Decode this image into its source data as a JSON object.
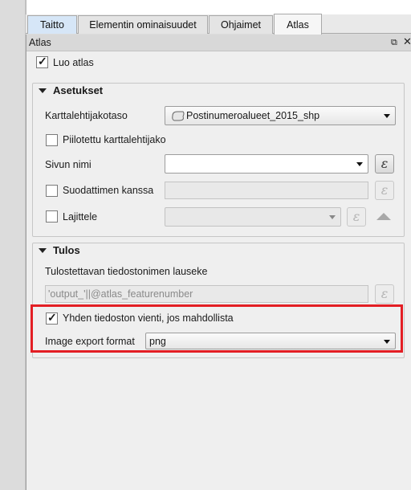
{
  "tabs": [
    "Taitto",
    "Elementin ominaisuudet",
    "Ohjaimet",
    "Atlas"
  ],
  "dock": {
    "title": "Atlas",
    "float_icon": "float-icon",
    "close_icon": "close-icon"
  },
  "generate_atlas": {
    "label": "Luo atlas",
    "checked": true
  },
  "settings": {
    "title": "Asetukset",
    "coverage_label": "Karttalehtijakotaso",
    "coverage_value": "Postinumeroalueet_2015_shp",
    "hidden_label": "Piilotettu karttalehtijako",
    "page_name_label": "Sivun nimi",
    "filter_label": "Suodattimen kanssa",
    "sort_label": "Lajittele",
    "expression_symbol": "ε"
  },
  "output": {
    "title": "Tulos",
    "filename_label": "Tulostettavan tiedostonimen lauseke",
    "filename_value": "'output_'||@atlas_featurenumber",
    "single_file_label": "Yhden tiedoston vienti, jos mahdollista",
    "single_file_checked": true,
    "image_format_label": "Image export format",
    "image_format_value": "png"
  },
  "colors": {
    "highlight": "#e31e24",
    "active_tab": "#f6f6f6"
  }
}
